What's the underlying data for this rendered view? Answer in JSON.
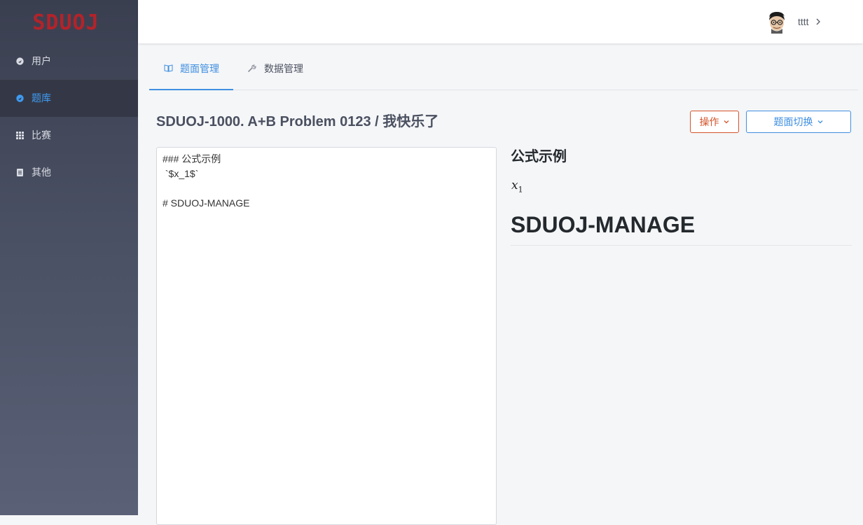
{
  "app": {
    "logo_text": "SDUOJ"
  },
  "sidebar": {
    "items": [
      {
        "label": "用户",
        "icon": "user-circle-icon",
        "active": false
      },
      {
        "label": "题库",
        "icon": "problem-set-icon",
        "active": true
      },
      {
        "label": "比赛",
        "icon": "grid-icon",
        "active": false
      },
      {
        "label": "其他",
        "icon": "document-icon",
        "active": false
      }
    ]
  },
  "header": {
    "username": "tttt",
    "avatar": "user-avatar"
  },
  "tabs": [
    {
      "label": "题面管理",
      "icon": "book-icon",
      "active": true
    },
    {
      "label": "数据管理",
      "icon": "wrench-icon",
      "active": false
    }
  ],
  "problem": {
    "title": "SDUOJ-1000. A+B Problem 0123 / 我快乐了"
  },
  "actions": {
    "operate_label": "操作",
    "switch_label": "题面切换"
  },
  "editor": {
    "lines": [
      "### 公式示例",
      " `$x_1$`",
      "",
      "# SDUOJ-MANAGE"
    ]
  },
  "preview": {
    "h3": "公式示例",
    "math_base": "x",
    "math_sub": "1",
    "h1": "SDUOJ-MANAGE"
  },
  "colors": {
    "accent": "#3f8fe0",
    "danger": "#d4542b",
    "sidebar_bg": "#4a5063",
    "logo": "#b3232a"
  }
}
